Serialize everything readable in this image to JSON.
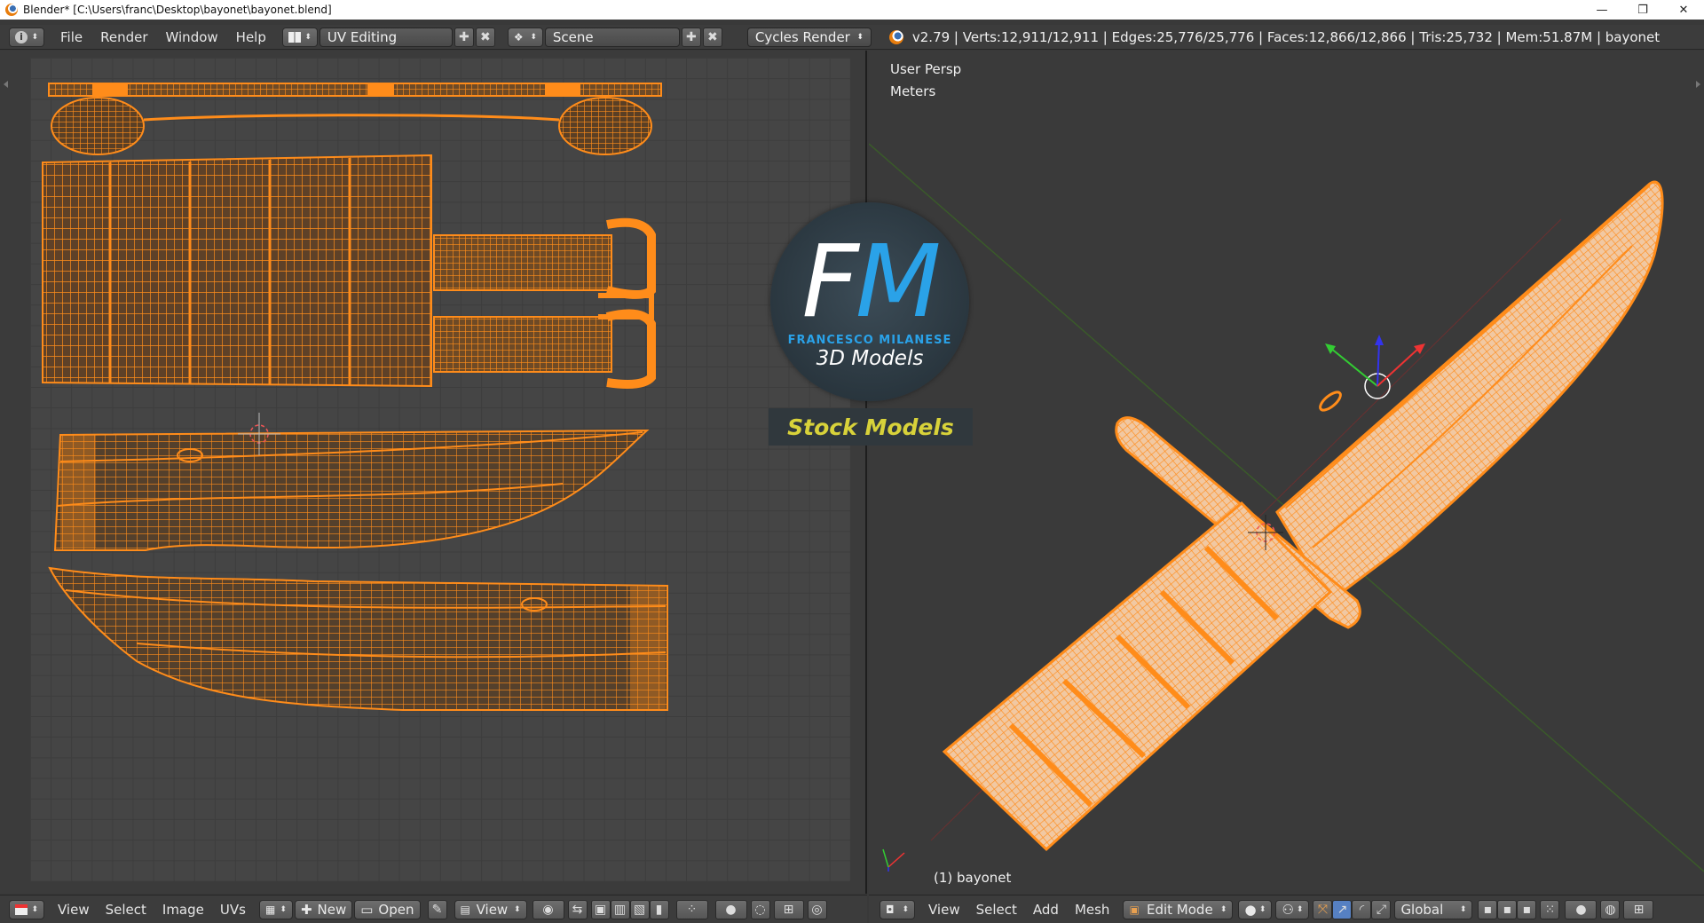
{
  "window": {
    "title": "Blender* [C:\\Users\\franc\\Desktop\\bayonet\\bayonet.blend]",
    "minimize": "—",
    "maximize": "❐",
    "close": "✕"
  },
  "info_header": {
    "editor_icon": "info-icon",
    "menus": [
      "File",
      "Render",
      "Window",
      "Help"
    ],
    "screen_layout": "UV Editing",
    "scene": "Scene",
    "render_engine": "Cycles Render",
    "stats": "v2.79 | Verts:12,911/12,911 | Edges:25,776/25,776 | Faces:12,866/12,866 | Tris:25,732 | Mem:51.87M | bayonet"
  },
  "viewport": {
    "view_name": "User Persp",
    "units": "Meters",
    "object_label": "(1) bayonet"
  },
  "uv_header": {
    "menus": [
      "View",
      "Select",
      "Image",
      "UVs"
    ],
    "new_label": "New",
    "open_label": "Open",
    "view_label": "View"
  },
  "view3d_header": {
    "menus": [
      "View",
      "Select",
      "Add",
      "Mesh"
    ],
    "mode": "Edit Mode",
    "orientation": "Global"
  },
  "watermark": {
    "letter_f": "F",
    "letter_m": "M",
    "name": "FRANCESCO MILANESE",
    "tagline": "3D Models",
    "badge": "Stock Models"
  },
  "colors": {
    "wire": "#ff8c1a",
    "mesh_fill": "#f0c8a0",
    "accent_blue": "#2aa2e8",
    "stock_yellow": "#d8d23a"
  }
}
